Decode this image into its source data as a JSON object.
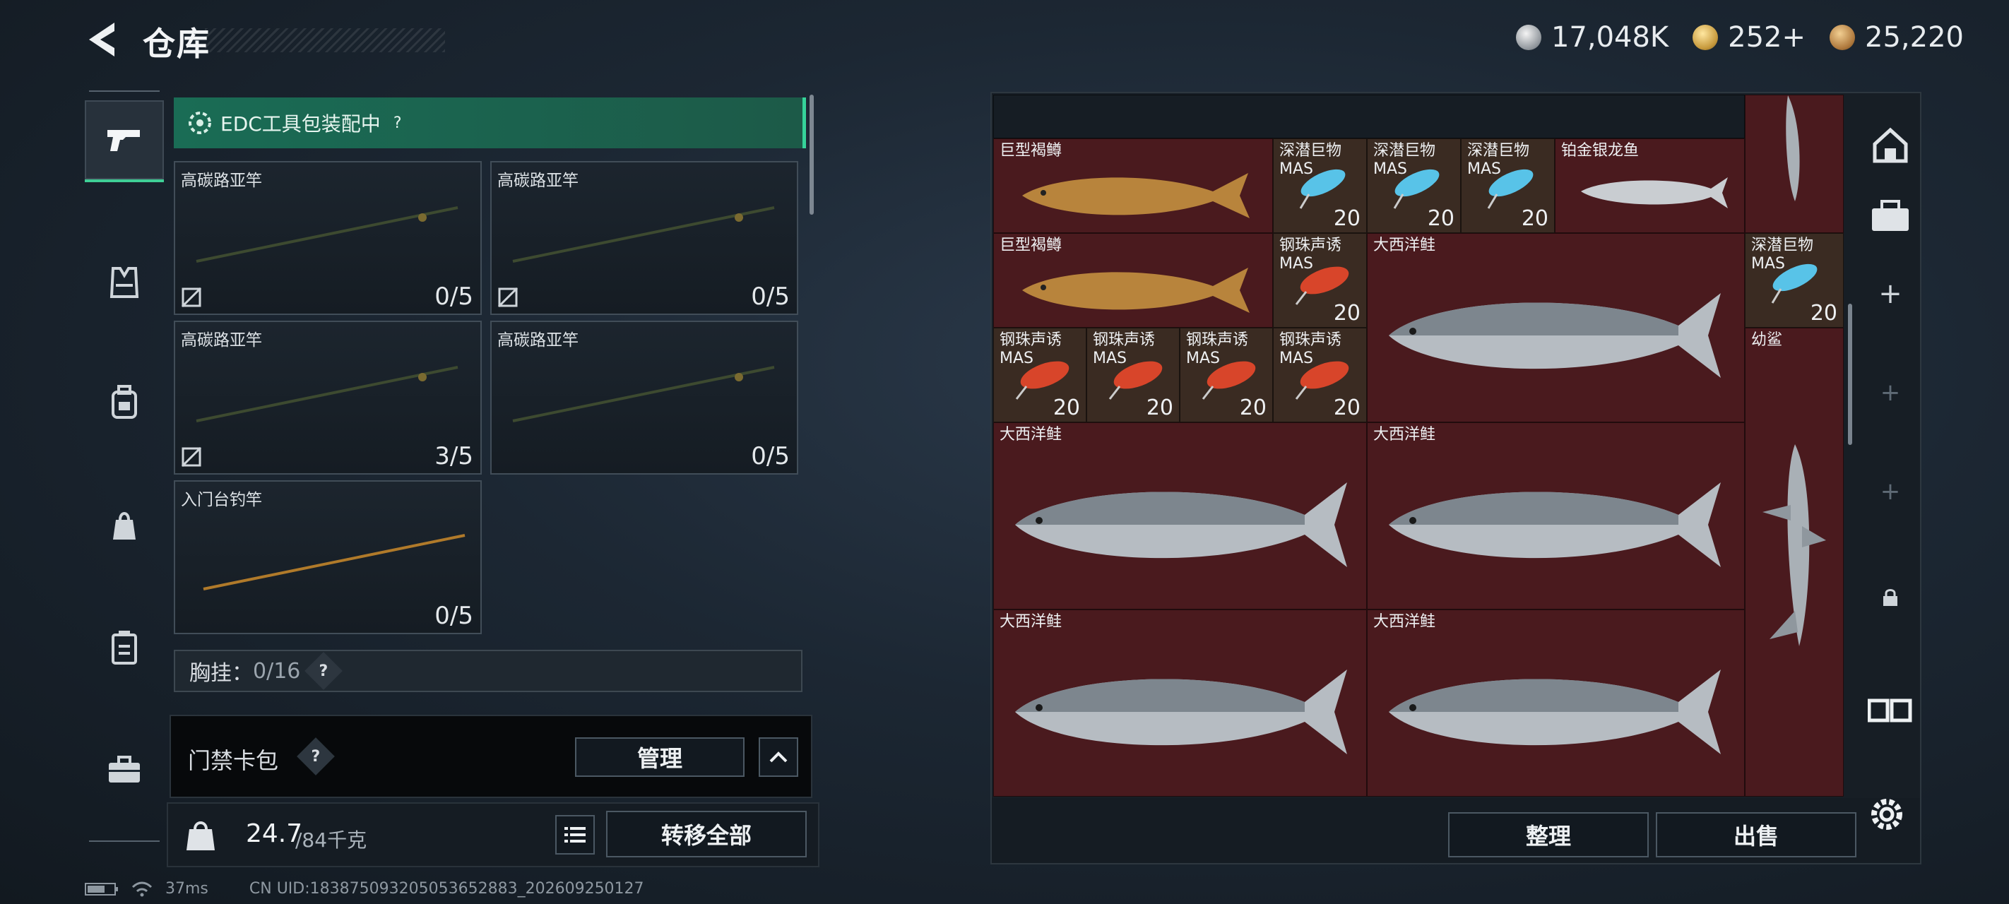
{
  "header": {
    "title": "仓库",
    "currencies": [
      {
        "icon": "silver-coin-icon",
        "value": "17,048K"
      },
      {
        "icon": "gold-triangle-coin-icon",
        "value": "252+"
      },
      {
        "icon": "bronze-coin-icon",
        "value": "25,220"
      }
    ]
  },
  "nav": [
    "pistol-icon",
    "vest-icon",
    "backpack-icon",
    "bag-icon",
    "case-icon",
    "toolbox-icon"
  ],
  "left": {
    "banner": "EDC工具包装配中",
    "banner_help": "?",
    "slots": [
      {
        "name": "高碳路亚竿",
        "count": "0/5"
      },
      {
        "name": "高碳路亚竿",
        "count": "0/5"
      },
      {
        "name": "高碳路亚竿",
        "count": "3/5"
      },
      {
        "name": "高碳路亚竿",
        "count": "0/5"
      },
      {
        "name": "入门台钓竿",
        "count": "0/5"
      }
    ],
    "chest_label": "胸挂：",
    "chest_value": "0/16",
    "chest_help": "?",
    "card_bag_label": "门禁卡包",
    "card_bag_help": "?",
    "manage_label": "管理",
    "weight_value": "24.7",
    "weight_max": "/84千克",
    "transfer_all_label": "转移全部"
  },
  "grid": {
    "items": [
      {
        "name": "巨型褐鳟",
        "qty": ""
      },
      {
        "name": "深潜巨物\nMAS",
        "qty": "20"
      },
      {
        "name": "深潜巨物\nMAS",
        "qty": "20"
      },
      {
        "name": "深潜巨物\nMAS",
        "qty": "20"
      },
      {
        "name": "铂金银龙鱼",
        "qty": ""
      },
      {
        "name": "巨型褐鳟",
        "qty": ""
      },
      {
        "name": "钢珠声诱\nMAS",
        "qty": "20"
      },
      {
        "name": "大西洋鲑",
        "qty": ""
      },
      {
        "name": "深潜巨物\nMAS",
        "qty": "20"
      },
      {
        "name": "钢珠声诱\nMAS",
        "qty": "20"
      },
      {
        "name": "钢珠声诱\nMAS",
        "qty": "20"
      },
      {
        "name": "钢珠声诱\nMAS",
        "qty": "20"
      },
      {
        "name": "钢珠声诱\nMAS",
        "qty": "20"
      },
      {
        "name": "幼鲨",
        "qty": ""
      },
      {
        "name": "大西洋鲑",
        "qty": ""
      },
      {
        "name": "大西洋鲑",
        "qty": ""
      },
      {
        "name": "大西洋鲑",
        "qty": ""
      },
      {
        "name": "大西洋鲑",
        "qty": ""
      }
    ],
    "sort_label": "整理",
    "sell_label": "出售"
  },
  "status": {
    "ping": "37ms",
    "uid": "CN UID:1838750932050536528​83_202609250127"
  }
}
